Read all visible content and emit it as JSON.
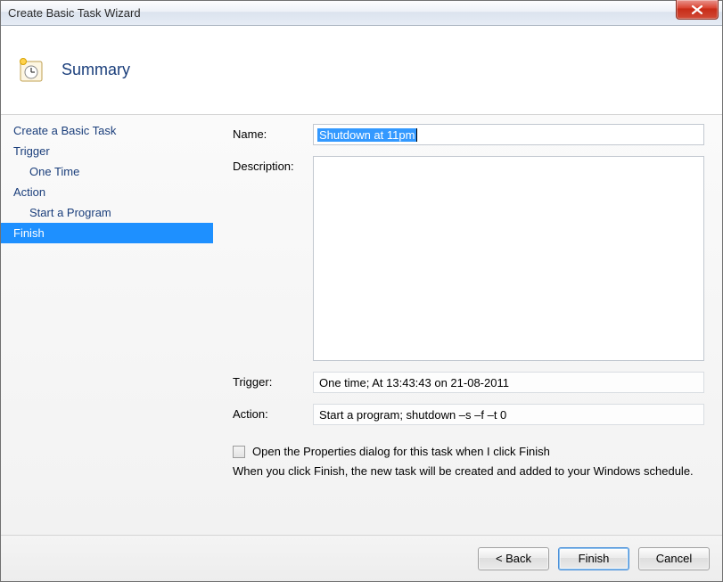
{
  "window": {
    "title": "Create Basic Task Wizard"
  },
  "header": {
    "title": "Summary"
  },
  "sidebar": {
    "items": [
      {
        "label": "Create a Basic Task",
        "sub": false,
        "selected": false
      },
      {
        "label": "Trigger",
        "sub": false,
        "selected": false
      },
      {
        "label": "One Time",
        "sub": true,
        "selected": false
      },
      {
        "label": "Action",
        "sub": false,
        "selected": false
      },
      {
        "label": "Start a Program",
        "sub": true,
        "selected": false
      },
      {
        "label": "Finish",
        "sub": false,
        "selected": true
      }
    ]
  },
  "labels": {
    "name": "Name:",
    "description": "Description:",
    "trigger": "Trigger:",
    "action": "Action:"
  },
  "fields": {
    "name": "Shutdown at 11pm",
    "description": "",
    "trigger": "One time; At 13:43:43 on 21-08-2011",
    "action": "Start a program; shutdown –s –f –t 0"
  },
  "checkbox": {
    "open_properties": "Open the Properties dialog for this task when I click Finish",
    "checked": false
  },
  "hint": "When you click Finish, the new task will be created and added to your Windows schedule.",
  "buttons": {
    "back": "< Back",
    "finish": "Finish",
    "cancel": "Cancel"
  }
}
